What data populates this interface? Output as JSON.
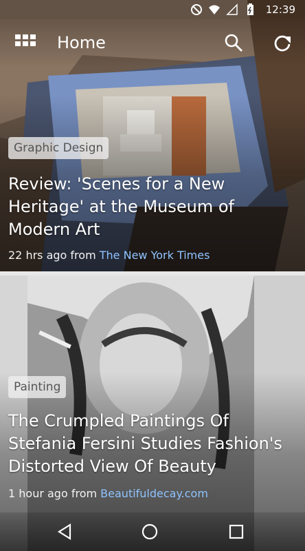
{
  "status_bar": {
    "time": "12:39"
  },
  "app_bar": {
    "title": "Home"
  },
  "articles": [
    {
      "category": "Graphic Design",
      "headline_lines": [
        "Review: 'Scenes for a New",
        "Heritage' at the Museum of",
        "Modern Art"
      ],
      "time_ago": "22 hrs ago from",
      "source": "The New York Times"
    },
    {
      "category": "Painting",
      "headline_lines": [
        "The Crumpled Paintings Of",
        "Stefania Fersini Studies Fashion's",
        "Distorted View Of Beauty"
      ],
      "time_ago": "1 hour ago from",
      "source": "Beautifuldecay.com"
    }
  ],
  "colors": {
    "source_link": "#8fc3ff",
    "tag_bg": "#f0f0f0",
    "divider": "#e8e8e8"
  }
}
